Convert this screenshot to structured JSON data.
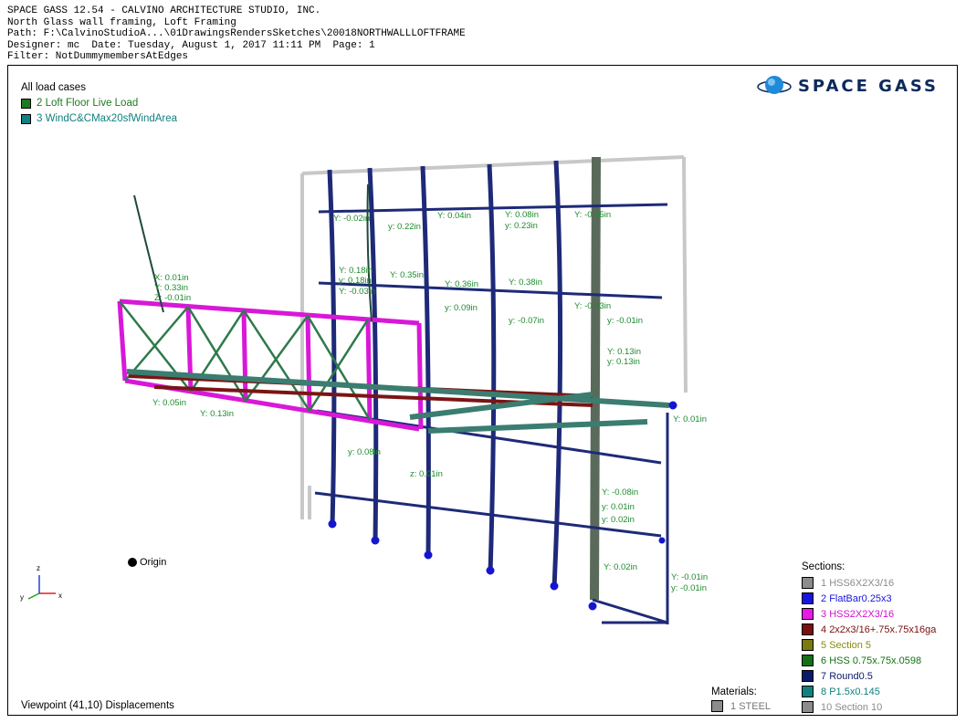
{
  "header": {
    "line1": "SPACE GASS 12.54 - CALVINO ARCHITECTURE STUDIO, INC.",
    "line2": "North Glass wall framing, Loft Framing",
    "line3": "Path: F:\\CalvinoStudioA...\\01DrawingsRendersSketches\\20018NORTHWALLLOFTFRAME",
    "line4": "Designer: mc  Date: Tuesday, August 1, 2017 11:11 PM  Page: 1",
    "line5": "Filter: NotDummymembersAtEdges"
  },
  "load_cases": {
    "title": "All load cases",
    "items": [
      {
        "label": "2 Loft Floor Live Load",
        "color": "#1e7a1e",
        "text_color": "#1e7a1e"
      },
      {
        "label": "3 WindC&CMax20sfWindArea",
        "color": "#128080",
        "text_color": "#128080"
      }
    ]
  },
  "logo": {
    "text": "SPACE GASS"
  },
  "origin_label": "Origin",
  "axis_labels": {
    "x": "x",
    "y": "y",
    "z": "z"
  },
  "viewport_label": "Viewpoint (41,10) Displacements",
  "sections": {
    "title": "Sections:",
    "items": [
      {
        "num": "1",
        "label": "HSS6X2X3/16",
        "color": "#8c8c8c",
        "text_color": "#8c8c8c"
      },
      {
        "num": "2",
        "label": "FlatBar0.25x3",
        "color": "#1515e0",
        "text_color": "#1515e0"
      },
      {
        "num": "3",
        "label": "HSS2X2X3/16",
        "color": "#e818e8",
        "text_color": "#d010d0"
      },
      {
        "num": "4",
        "label": "2x2x3/16+.75x.75x16ga",
        "color": "#7a1010",
        "text_color": "#7a1010"
      },
      {
        "num": "5",
        "label": "Section 5",
        "color": "#7a7a10",
        "text_color": "#8a8a10"
      },
      {
        "num": "6",
        "label": "HSS 0.75x.75x.0598",
        "color": "#157015",
        "text_color": "#157015"
      },
      {
        "num": "7",
        "label": "Round0.5",
        "color": "#0c1a6a",
        "text_color": "#0c1a6a"
      },
      {
        "num": "8",
        "label": "P1.5x0.145",
        "color": "#108080",
        "text_color": "#108080"
      },
      {
        "num": "10",
        "label": "Section 10",
        "color": "#8c8c8c",
        "text_color": "#8c8c8c"
      }
    ]
  },
  "materials": {
    "title": "Materials:",
    "items": [
      {
        "num": "1",
        "label": "STEEL",
        "color": "#8c8c8c"
      }
    ]
  },
  "displacement_labels": [
    "X: 0.01in",
    "Y: 0.33in",
    "Z: -0.01in",
    "Y: -0.02in",
    "Y: 0.04in",
    "y: 0.22in",
    "Y: 0.08in",
    "y: 0.23in",
    "Y: -0.05in",
    "Y: 0.18in",
    "Y: 0.35in",
    "Y: 0.36in",
    "Y: 0.38in",
    "y: 0.18in",
    "Y: -0.03in",
    "y: 0.09in",
    "y: -0.07in",
    "Y: -0.03in",
    "y: -0.01in",
    "Y: 0.13in",
    "y: 0.13in",
    "Y: 0.05in",
    "Y: 0.13in",
    "y: 0.08in",
    "Y: -0.08in",
    "z: 0.01in",
    "Y: 0.02in",
    "Y: -0.01in",
    "y: -0.01in",
    "y: 0.01in",
    "y: 0.02in",
    "Y: 0.01in"
  ]
}
